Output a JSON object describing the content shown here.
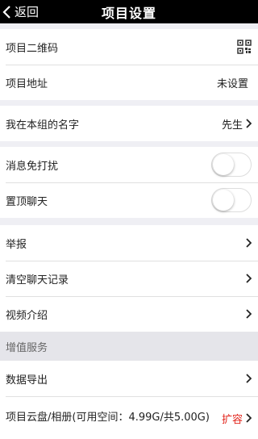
{
  "header": {
    "back_label": "返回",
    "title": "项目设置"
  },
  "rows": {
    "qr_label": "项目二维码",
    "address_label": "项目地址",
    "address_value": "未设置",
    "nickname_label": "我在本组的名字",
    "nickname_value": "先生",
    "mute_label": "消息免打扰",
    "pin_label": "置顶聊天",
    "report_label": "举报",
    "clear_label": "清空聊天记录",
    "video_label": "视频介绍"
  },
  "section": {
    "value_added": "增值服务"
  },
  "rows2": {
    "export_label": "数据导出",
    "cloud_label": "项目云盘/相册(可用空间：4.99G/共5.00G)",
    "cloud_value": "扩容"
  },
  "colors": {
    "accent_red": "#e2231a",
    "header_bg": "#000000"
  },
  "toggles": {
    "mute": false,
    "pin": false
  }
}
